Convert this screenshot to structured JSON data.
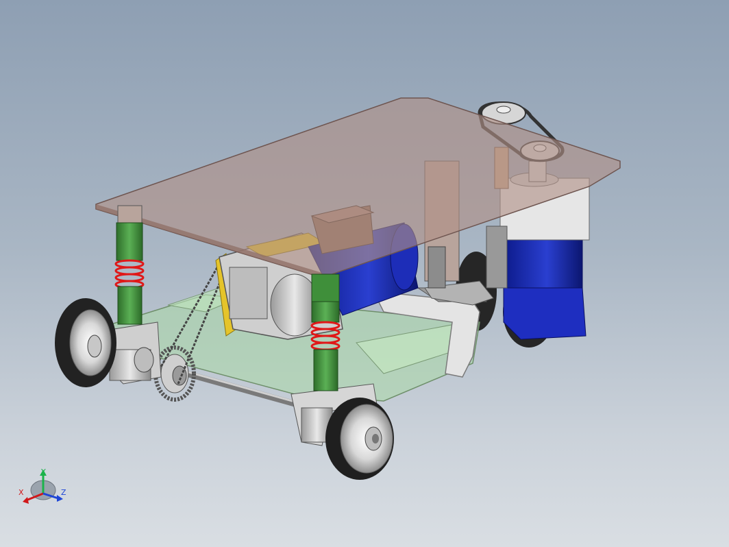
{
  "viewport": {
    "background_top": "#8e9fb3",
    "background_bottom": "#d9dee3"
  },
  "model": {
    "colors": {
      "deck": "#b08f86",
      "frame": "#a9d8a6",
      "motor_blue": "#1f2fb0",
      "shock_green": "#3f8f3a",
      "spring_red": "#e01818",
      "gearbox_grey": "#c8c8c8",
      "gearbox_yellow": "#e5c42a",
      "brown_block": "#8a6a58",
      "tire": "#2b2b2b",
      "rim": "#e6e6e6"
    }
  },
  "triad": {
    "x_label": "X",
    "y_label": "Y",
    "z_label": "Z",
    "x_color": "#d0181a",
    "y_color": "#1bb34b",
    "z_color": "#1d45d6"
  }
}
